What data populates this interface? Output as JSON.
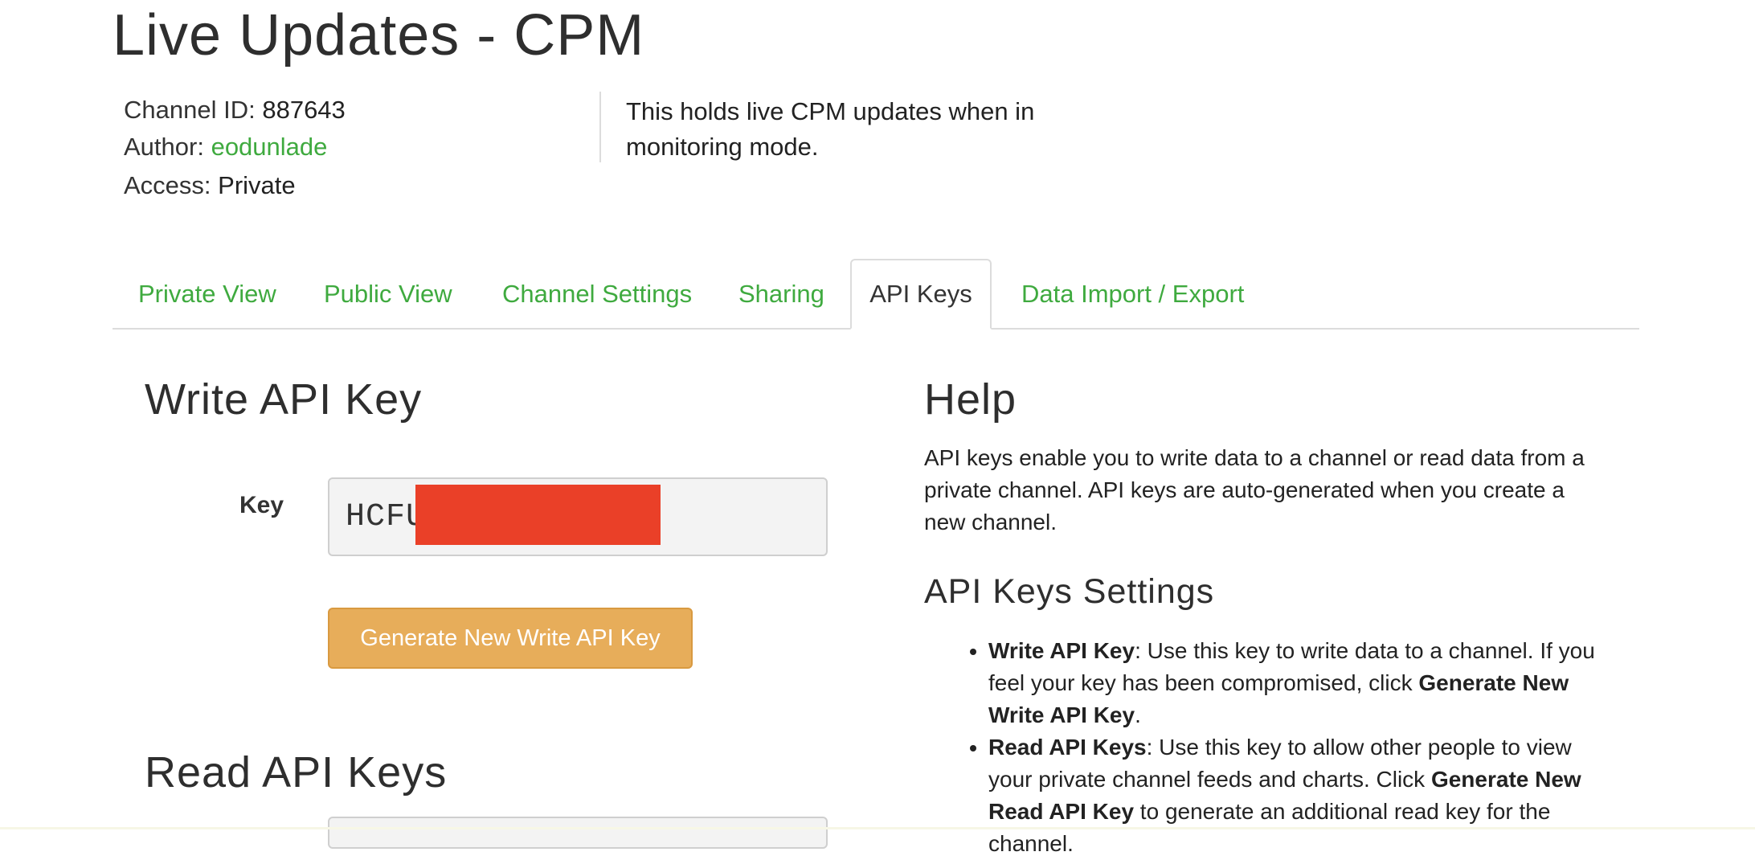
{
  "page": {
    "title": "Live Updates - CPM"
  },
  "channel": {
    "id_label": "Channel ID:",
    "id_value": "887643",
    "author_label": "Author:",
    "author_value": "eodunlade",
    "access_label": "Access:",
    "access_value": "Private",
    "description": "This holds live CPM updates when in monitoring mode."
  },
  "tabs": [
    {
      "label": "Private View",
      "active": false
    },
    {
      "label": "Public View",
      "active": false
    },
    {
      "label": "Channel Settings",
      "active": false
    },
    {
      "label": "Sharing",
      "active": false
    },
    {
      "label": "API Keys",
      "active": true
    },
    {
      "label": "Data Import / Export",
      "active": false
    }
  ],
  "write_key": {
    "heading": "Write API Key",
    "key_label": "Key",
    "key_value": "HCFU",
    "button_label": "Generate New Write API Key"
  },
  "read_keys": {
    "heading": "Read API Keys"
  },
  "help": {
    "heading": "Help",
    "text": "API keys enable you to write data to a channel or read data from a private channel. API keys are auto-generated when you create a new channel.",
    "settings_heading": "API Keys Settings",
    "items": [
      {
        "term": "Write API Key",
        "text_before": ": Use this key to write data to a channel. If you feel your key has been compromised, click ",
        "bold_action": "Generate New Write API Key",
        "text_after": "."
      },
      {
        "term": "Read API Keys",
        "text_before": ": Use this key to allow other people to view your private channel feeds and charts. Click ",
        "bold_action": "Generate New Read API Key",
        "text_after": " to generate an additional read key for the channel."
      }
    ]
  },
  "colors": {
    "link_green": "#3faa3f",
    "button_orange": "#e7ad5a",
    "redaction_red": "#ea4028"
  }
}
